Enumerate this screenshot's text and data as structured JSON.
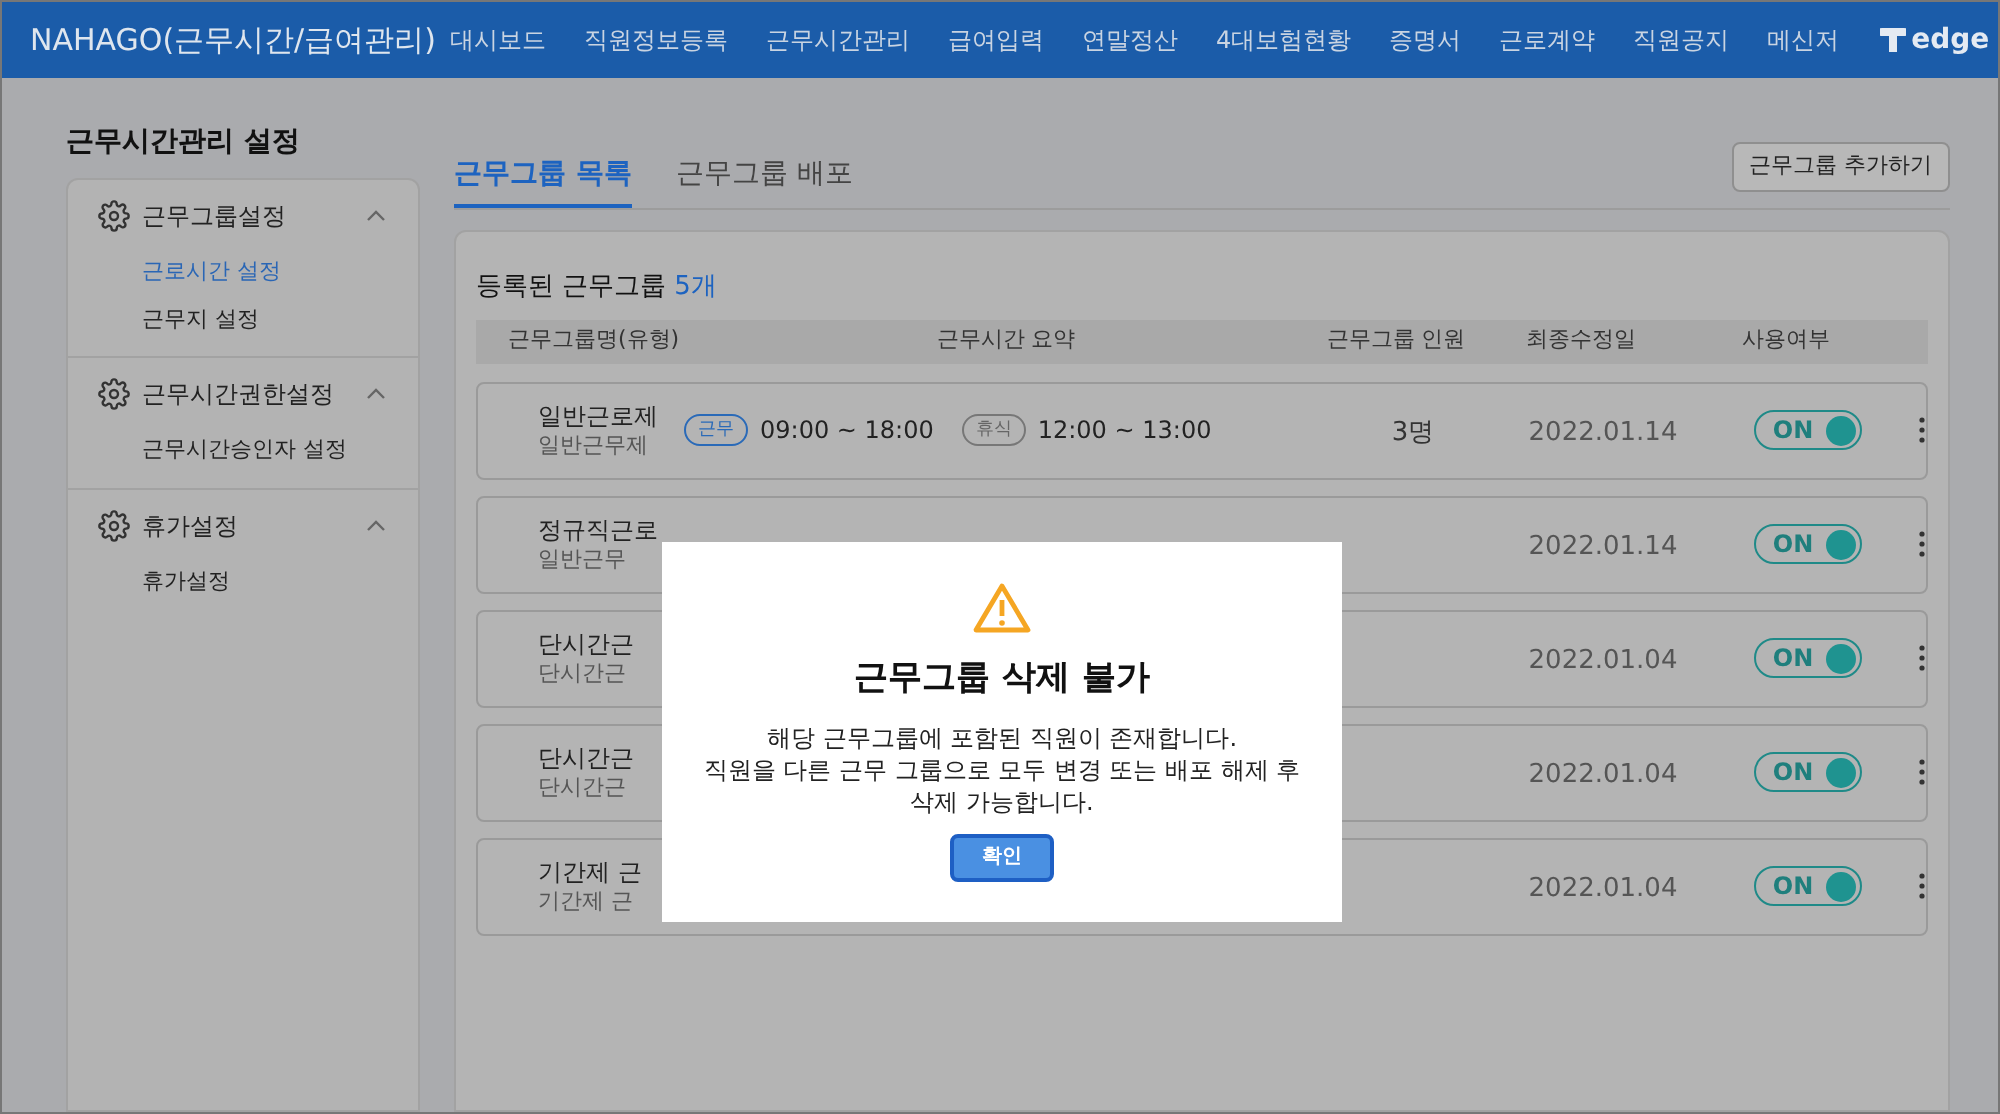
{
  "app_title": "NAHAGO(근무시간/급여관리)",
  "nav": [
    {
      "label": "대시보드"
    },
    {
      "label": "직원정보등록"
    },
    {
      "label": "근무시간관리"
    },
    {
      "label": "급여입력"
    },
    {
      "label": "연말정산"
    },
    {
      "label": "4대보험현황"
    },
    {
      "label": "증명서"
    },
    {
      "label": "근로계약"
    },
    {
      "label": "직원공지"
    },
    {
      "label": "메신저"
    }
  ],
  "logo_text": "edge",
  "page_title": "근무시간관리 설정",
  "sidebar": [
    {
      "title": "근무그룹설정",
      "expanded": true,
      "children": [
        {
          "label": "근로시간 설정",
          "selected": true
        },
        {
          "label": "근무지 설정",
          "selected": false
        }
      ]
    },
    {
      "title": "근무시간권한설정",
      "expanded": true,
      "children": [
        {
          "label": "근무시간승인자 설정",
          "selected": false
        }
      ]
    },
    {
      "title": "휴가설정",
      "expanded": true,
      "children": [
        {
          "label": "휴가설정",
          "selected": false
        }
      ]
    }
  ],
  "tabs": [
    {
      "label": "근무그룹 목록",
      "selected": true
    },
    {
      "label": "근무그룹 배포",
      "selected": false
    }
  ],
  "add_button": "근무그룹 추가하기",
  "list_title": "등록된 근무그룹",
  "list_count": "5개",
  "columns": [
    "근무그룹명(유형)",
    "근무시간 요약",
    "근무그룹 인원",
    "최종수정일",
    "사용여부"
  ],
  "rows": [
    {
      "name": "일반근로제",
      "type": "일반근무제",
      "work_badge": "근무",
      "work_time": "09:00 ~ 18:00",
      "break_badge": "휴식",
      "break_time": "12:00 ~ 13:00",
      "members": "3명",
      "date": "2022.01.14",
      "toggle": "ON",
      "on": true
    },
    {
      "name": "정규직근로",
      "type": "일반근무",
      "date": "2022.01.14",
      "toggle": "ON",
      "on": true
    },
    {
      "name": "단시간근",
      "type": "단시간근",
      "date": "2022.01.04",
      "toggle": "ON",
      "on": true
    },
    {
      "name": "단시간근",
      "type": "단시간근",
      "date": "2022.01.04",
      "toggle": "ON",
      "on": true
    },
    {
      "name": "기간제 근",
      "type": "기간제 근",
      "date": "2022.01.04",
      "toggle": "ON",
      "on": true
    }
  ],
  "dialog": {
    "title": "근무그룹 삭제 불가",
    "message_lines": [
      "해당 근무그룹에 포함된 직원이 존재합니다.",
      "직원을 다른 근무 그룹으로 모두 변경 또는 배포 해제 후",
      "삭제 가능합니다."
    ],
    "button": "확인"
  }
}
